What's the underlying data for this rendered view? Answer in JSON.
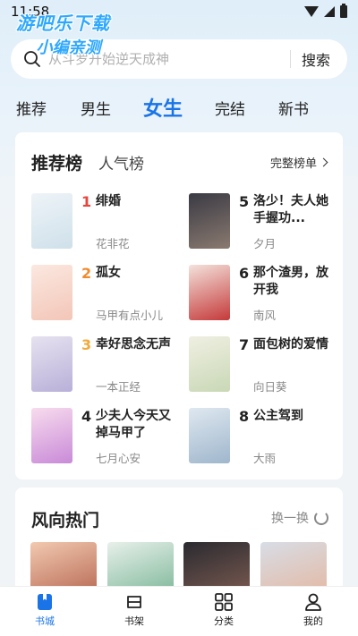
{
  "status_bar": {
    "time": "11:58"
  },
  "watermark": {
    "line1": "游吧乐下载",
    "line2": "小编亲测"
  },
  "search": {
    "placeholder": "从斗罗开始逆天成神",
    "button_label": "搜索"
  },
  "tabs": [
    {
      "label": "推荐",
      "active": false
    },
    {
      "label": "男生",
      "active": false
    },
    {
      "label": "女生",
      "active": true
    },
    {
      "label": "完结",
      "active": false
    },
    {
      "label": "新书",
      "active": false
    }
  ],
  "ranking": {
    "title": "推荐榜",
    "subtitle": "人气榜",
    "full_link": "完整榜单",
    "books": [
      {
        "rank": "1",
        "title": "绯婚",
        "author": "花非花",
        "rank_color": "#e8453c",
        "cover_colors": [
          "#eef4f8",
          "#cfe0ea"
        ]
      },
      {
        "rank": "5",
        "title": "洛少！夫人她手握功...",
        "author": "夕月",
        "rank_color": "#222222",
        "cover_colors": [
          "#3a3a44",
          "#8a7a70"
        ]
      },
      {
        "rank": "2",
        "title": "孤女",
        "author": "马甲有点小儿",
        "rank_color": "#f08a2c",
        "cover_colors": [
          "#fbe8e0",
          "#f3c6b8"
        ]
      },
      {
        "rank": "6",
        "title": "那个渣男，放开我",
        "author": "南风",
        "rank_color": "#222222",
        "cover_colors": [
          "#f4e2dc",
          "#c43a3a"
        ]
      },
      {
        "rank": "3",
        "title": "幸好思念无声",
        "author": "一本正经",
        "rank_color": "#f2a93b",
        "cover_colors": [
          "#e6e2f0",
          "#b9b0d8"
        ]
      },
      {
        "rank": "7",
        "title": "面包树的爱情",
        "author": "向日葵",
        "rank_color": "#222222",
        "cover_colors": [
          "#f0efe2",
          "#c9d8b6"
        ]
      },
      {
        "rank": "4",
        "title": "少夫人今天又掉马甲了",
        "author": "七月心安",
        "rank_color": "#222222",
        "cover_colors": [
          "#f8dcee",
          "#c98ad8"
        ]
      },
      {
        "rank": "8",
        "title": "公主驾到",
        "author": "大雨",
        "rank_color": "#222222",
        "cover_colors": [
          "#dfe8f0",
          "#9fb6cc"
        ]
      }
    ]
  },
  "trending": {
    "title": "风向热门",
    "refresh_label": "换一换",
    "covers": [
      {
        "colors": [
          "#f2c9b0",
          "#b86a55"
        ]
      },
      {
        "colors": [
          "#e8f0ea",
          "#7fb89a"
        ]
      },
      {
        "colors": [
          "#2a2a30",
          "#7a5a50"
        ]
      },
      {
        "colors": [
          "#d8dde6",
          "#e3b9a4"
        ]
      }
    ]
  },
  "bottom_nav": [
    {
      "label": "书城",
      "icon": "bookstore-icon",
      "active": true
    },
    {
      "label": "书架",
      "icon": "bookshelf-icon",
      "active": false
    },
    {
      "label": "分类",
      "icon": "category-icon",
      "active": false
    },
    {
      "label": "我的",
      "icon": "profile-icon",
      "active": false
    }
  ],
  "colors": {
    "accent": "#1a74e8",
    "rank1": "#e8453c",
    "rank2": "#f08a2c",
    "rank3": "#f2a93b"
  }
}
